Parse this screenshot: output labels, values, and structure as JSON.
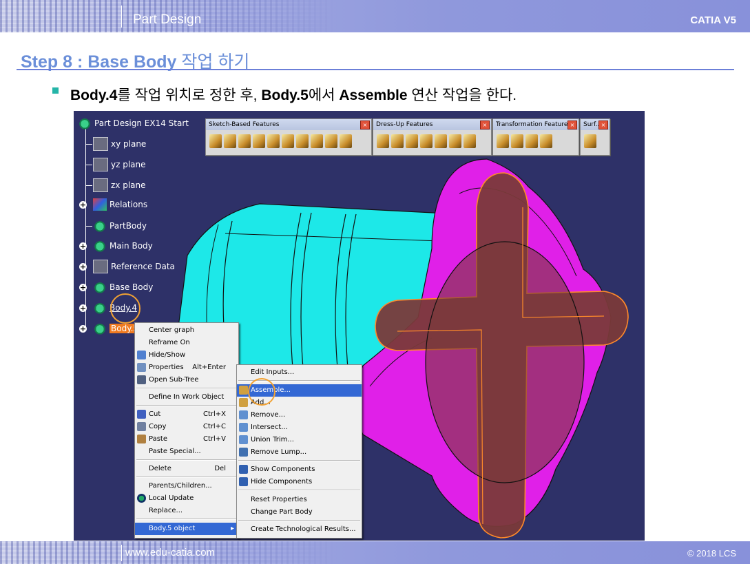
{
  "slide": {
    "header_title": "Part Design",
    "header_right": "CATIA V5",
    "step_title": "Step 8 : Base Body",
    "step_title_ko": " 작업 하기",
    "instruction": {
      "part1_bold": "Body.4",
      "part2": "를 작업 위치로 정한 후, ",
      "part3_bold": "Body.5",
      "part4": "에서 ",
      "part5_bold": "Assemble",
      "part6": " 연산 작업을 한다."
    },
    "footer_site": "www.edu-catia.com",
    "footer_copy": "© 2018 LCS"
  },
  "tree": {
    "root": "Part Design EX14 Start",
    "items": [
      "xy plane",
      "yz plane",
      "zx plane",
      "Relations",
      "PartBody",
      "Main Body",
      "Reference Data",
      "Base Body",
      "Body.4",
      "Body.5"
    ]
  },
  "toolbars": {
    "sketch": "Sketch-Based Features",
    "dressup": "Dress-Up Features",
    "transform": "Transformation Features",
    "surf": "Surf..."
  },
  "context_menu": {
    "items": [
      "Center graph",
      "Reframe On",
      "Hide/Show",
      "Properties",
      "Open Sub-Tree",
      "Define In Work Object",
      "Cut",
      "Copy",
      "Paste",
      "Paste Special...",
      "Delete",
      "Parents/Children...",
      "Local Update",
      "Replace...",
      "Body.5 object"
    ],
    "shortcuts": {
      "properties": "Alt+Enter",
      "cut": "Ctrl+X",
      "copy": "Ctrl+C",
      "paste": "Ctrl+V",
      "delete": "Del"
    }
  },
  "submenu": {
    "items": [
      "Edit Inputs...",
      "Assemble...",
      "Add...",
      "Remove...",
      "Intersect...",
      "Union Trim...",
      "Remove Lump...",
      "Show Components",
      "Hide Components",
      "Reset Properties",
      "Change Part Body",
      "Create Technological Results..."
    ]
  },
  "colors": {
    "accent_title": "#6b8fd9",
    "viewport_bg": "#2e3168",
    "cyan_part": "#1de8e8",
    "magenta_part": "#e020e8",
    "cross_part": "#7a3a3a",
    "highlight": "#f2a233",
    "menu_select": "#3368d4"
  }
}
